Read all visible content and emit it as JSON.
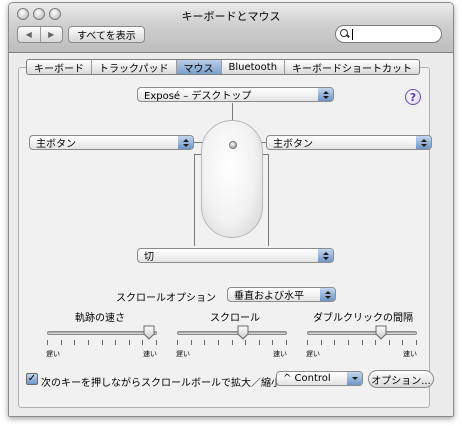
{
  "window": {
    "title": "キーボードとマウス"
  },
  "toolbar": {
    "back_symbol": "◀",
    "forward_symbol": "▶",
    "show_all_label": "すべてを表示",
    "search_value": ""
  },
  "tabs": [
    {
      "label": "キーボード",
      "selected": false
    },
    {
      "label": "トラックパッド",
      "selected": false
    },
    {
      "label": "マウス",
      "selected": true
    },
    {
      "label": "Bluetooth",
      "selected": false
    },
    {
      "label": "キーボードショートカット",
      "selected": false
    }
  ],
  "help": {
    "symbol": "?"
  },
  "mouse_config": {
    "top_button": "Exposé – デスクトップ",
    "left_button": "主ボタン",
    "right_button": "主ボタン",
    "bottom_button": "切",
    "logo_symbol": ""
  },
  "scroll": {
    "label": "スクロールオプション",
    "value": "垂直および水平"
  },
  "sliders": [
    {
      "label": "軌跡の速さ",
      "min_label": "遅い",
      "max_label": "速い",
      "value_fraction": 0.98
    },
    {
      "label": "スクロール",
      "min_label": "遅い",
      "max_label": "速い",
      "value_fraction": 0.61
    },
    {
      "label": "ダブルクリックの間隔",
      "min_label": "遅い",
      "max_label": "速い",
      "value_fraction": 0.69
    }
  ],
  "zoom": {
    "checkbox_checked": true,
    "checkmark": "✓",
    "label": "次のキーを押しながらスクロールボールで拡大／縮小",
    "modifier_value": "^ Control",
    "options_button": "オプション..."
  },
  "colors": {
    "accent": "#6e96c8",
    "selected_tab": "#7aa0cc",
    "help": "#5a3ea0"
  }
}
